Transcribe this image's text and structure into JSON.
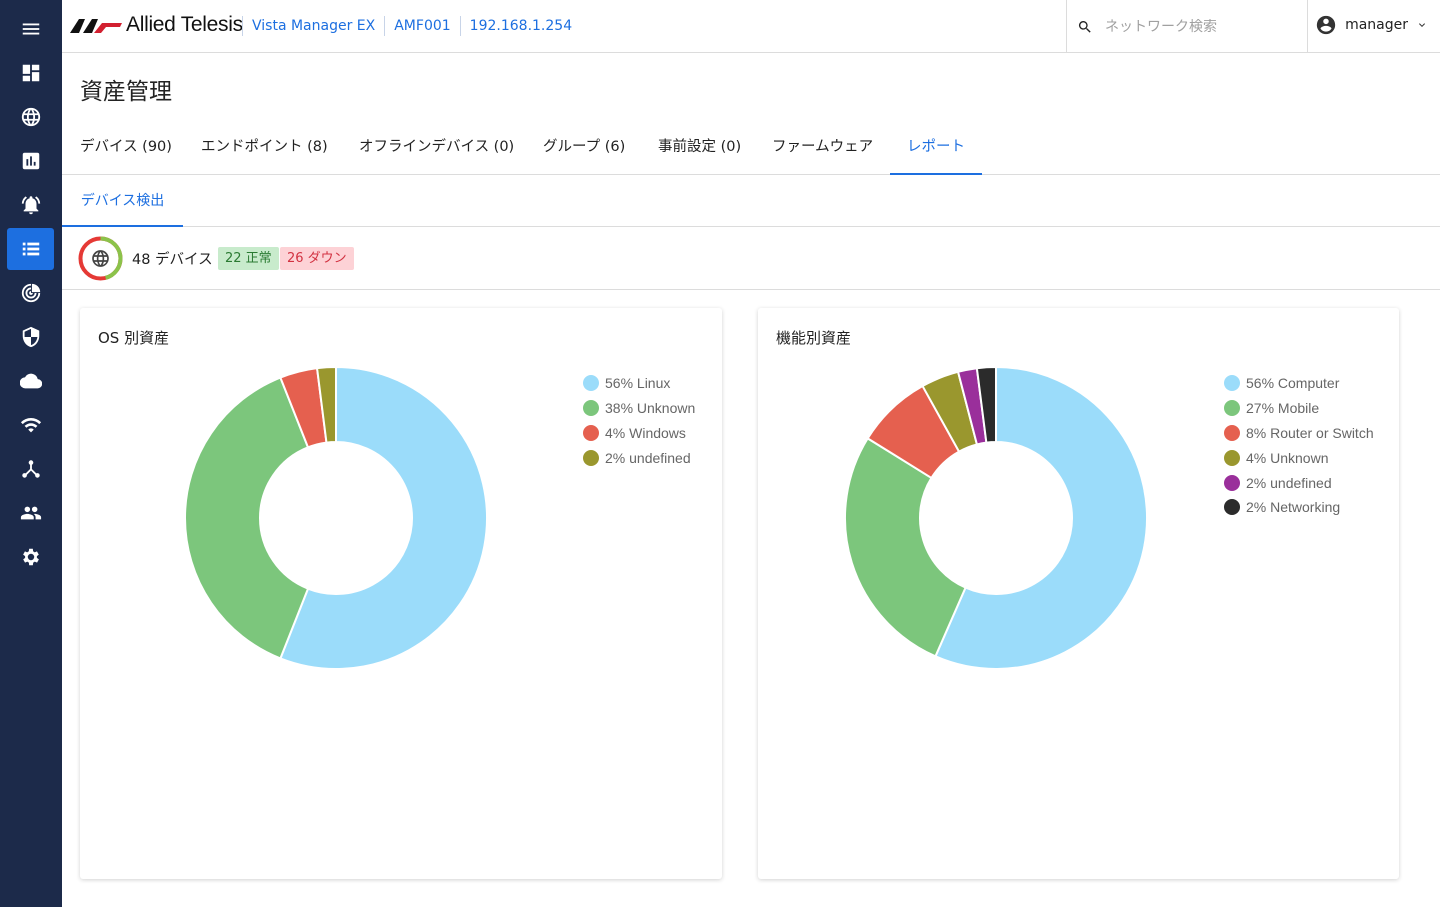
{
  "app": {
    "brand": "Allied Telesis",
    "product": "Vista Manager EX",
    "node": "AMF001",
    "ip": "192.168.1.254"
  },
  "search": {
    "placeholder": "ネットワーク検索"
  },
  "user": {
    "name": "manager"
  },
  "sidebar": {
    "items": [
      {
        "icon": "menu-icon"
      },
      {
        "icon": "dashboard-icon"
      },
      {
        "icon": "globe-icon"
      },
      {
        "icon": "bar-chart-icon"
      },
      {
        "icon": "alarm-icon"
      },
      {
        "icon": "list-icon",
        "active": true
      },
      {
        "icon": "radar-icon"
      },
      {
        "icon": "shield-icon"
      },
      {
        "icon": "cloud-icon"
      },
      {
        "icon": "wifi-icon"
      },
      {
        "icon": "network-icon"
      },
      {
        "icon": "people-icon"
      },
      {
        "icon": "gear-icon"
      }
    ]
  },
  "page": {
    "title": "資産管理"
  },
  "tabs": [
    {
      "label": "デバイス (90)"
    },
    {
      "label": "エンドポイント (8)"
    },
    {
      "label": "オフラインデバイス (0)"
    },
    {
      "label": "グループ (6)"
    },
    {
      "label": "事前設定 (0)"
    },
    {
      "label": "ファームウェア"
    },
    {
      "label": "レポート",
      "active": true
    }
  ],
  "subtabs": [
    {
      "label": "デバイス検出",
      "active": true
    }
  ],
  "summary": {
    "devices_label": "48 デバイス",
    "ok_label": "22 正常",
    "down_label": "26 ダウン",
    "ok_count": 22,
    "down_count": 26,
    "colors": {
      "ok": "#8bc34a",
      "down": "#e53935"
    }
  },
  "chart_data": [
    {
      "type": "pie",
      "title": "OS 別資産",
      "legend_placement": "top-right",
      "categories": [
        "Linux",
        "Unknown",
        "Windows",
        "undefined"
      ],
      "values": [
        56,
        38,
        4,
        2
      ],
      "legend_labels": [
        "56% Linux",
        "38% Unknown",
        "4% Windows",
        "2% undefined"
      ],
      "colors": [
        "#9bdcfa",
        "#7cc67c",
        "#e5604f",
        "#9a972e"
      ]
    },
    {
      "type": "pie",
      "title": "機能別資産",
      "legend_placement": "top-right",
      "categories": [
        "Computer",
        "Mobile",
        "Router or Switch",
        "Unknown",
        "undefined",
        "Networking"
      ],
      "values": [
        56,
        27,
        8,
        4,
        2,
        2
      ],
      "legend_labels": [
        "56% Computer",
        "27% Mobile",
        "8% Router or Switch",
        "4% Unknown",
        "2% undefined",
        "2% Networking"
      ],
      "colors": [
        "#9bdcfa",
        "#7cc67c",
        "#e5604f",
        "#9a972e",
        "#9a2f9b",
        "#2b2b2b"
      ]
    }
  ]
}
